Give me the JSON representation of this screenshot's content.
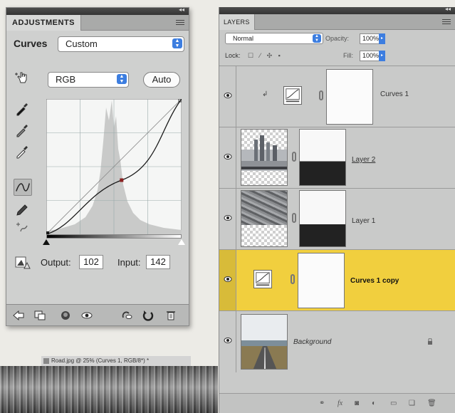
{
  "adjustments_panel": {
    "tab_label": "ADJUSTMENTS",
    "adjustment_label": "Curves",
    "preset_value": "Custom",
    "channel_value": "RGB",
    "auto_button_label": "Auto",
    "output_label": "Output:",
    "output_value": "102",
    "input_label": "Input:",
    "input_value": "142"
  },
  "curve": {
    "input_range": [
      0,
      255
    ],
    "output_range": [
      0,
      255
    ],
    "control_point": {
      "input": 142,
      "output": 102
    },
    "grid_divisions": 4
  },
  "document_tab": {
    "title": "Road.jpg @ 25% (Curves 1, RGB/8*) *"
  },
  "layers_panel": {
    "tab_label": "LAYERS",
    "blend_mode": "Normal",
    "opacity_label": "Opacity:",
    "opacity_value": "100%",
    "lock_label": "Lock:",
    "fill_label": "Fill:",
    "fill_value": "100%",
    "layers": [
      {
        "name": "Curves 1",
        "type": "adjustment",
        "selected": false,
        "clipped": true
      },
      {
        "name": "Layer 2",
        "type": "pixel-with-mask",
        "selected": false
      },
      {
        "name": "Layer 1",
        "type": "pixel-with-mask",
        "selected": false
      },
      {
        "name": "Curves 1 copy",
        "type": "adjustment",
        "selected": true
      },
      {
        "name": "Background",
        "type": "background",
        "selected": false,
        "locked": true
      }
    ]
  },
  "colors": {
    "panel_bg": "#cfd0cf",
    "selected_layer": "#f1cf3e",
    "accent_blue": "#3d7ee0",
    "titlebar": "#3d3d3d"
  }
}
